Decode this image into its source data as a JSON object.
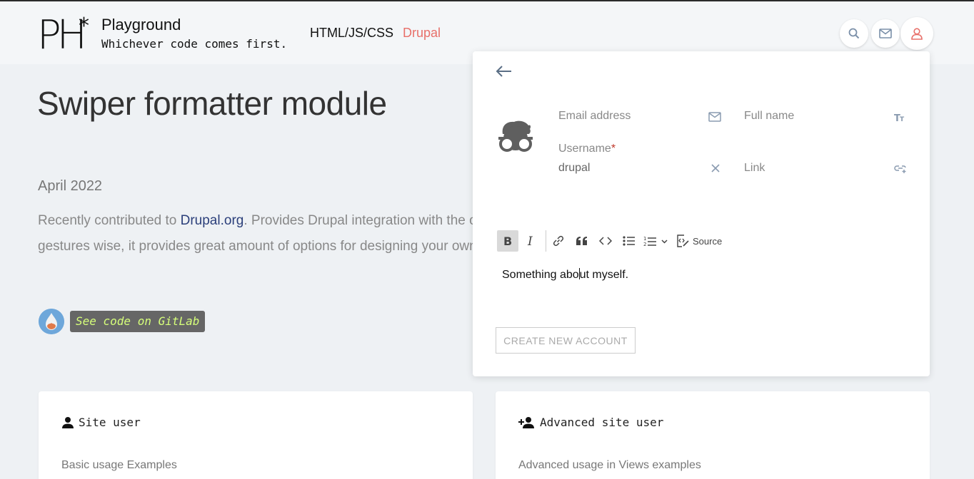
{
  "header": {
    "logo_text": "PH*",
    "title": "Playground",
    "tagline": "Whichever code comes first.",
    "nav": [
      {
        "label": "HTML/JS/CSS"
      },
      {
        "label": "Drupal"
      }
    ],
    "icons": [
      "search-icon",
      "mail-icon",
      "user-icon"
    ],
    "accent_color": "#e8706a"
  },
  "page": {
    "title": "Swiper formatter module",
    "date": "April 2022",
    "desc_prefix": "Recently contributed to ",
    "desc_link": "Drupal.org",
    "desc_rest_line1": ". Provides Drupal integration with the one",
    "desc_line2": "gestures wise, it provides great amount of options for designing your own w",
    "gitlab_label": "See code on GitLab"
  },
  "cards": [
    {
      "title": "Site user",
      "subtitle": "Basic usage Examples"
    },
    {
      "title": "Advanced site user",
      "subtitle": "Advanced usage in Views examples"
    }
  ],
  "panel": {
    "email_placeholder": "Email address",
    "fullname_placeholder": "Full name",
    "username_label": "Username",
    "username_required": "*",
    "username_value": "drupal",
    "link_placeholder": "Link",
    "toolbar_source": "Source",
    "editor_before": "Something abo",
    "editor_after": "ut myself.",
    "create_button": "CREATE NEW ACCOUNT"
  }
}
